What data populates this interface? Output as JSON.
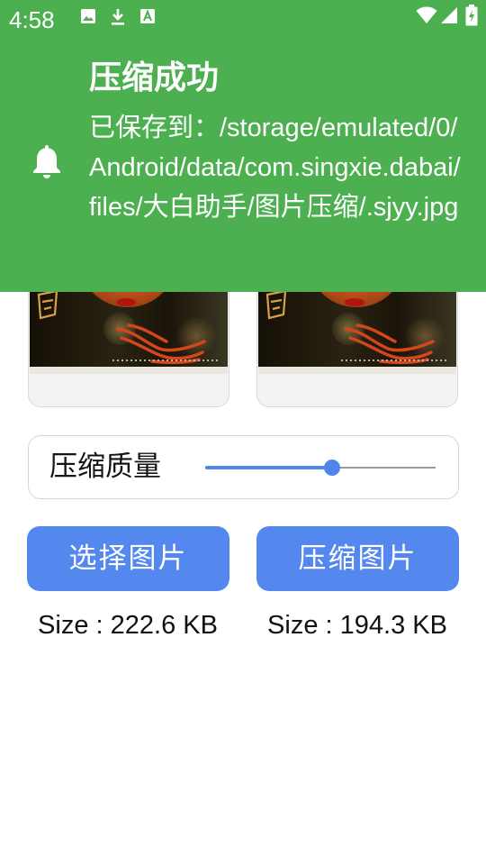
{
  "status_bar": {
    "time": "4:58",
    "left_icons": [
      "image-icon",
      "download-icon",
      "text-a-icon"
    ],
    "right_icons": [
      "wifi-icon",
      "cell-signal-icon",
      "battery-charging-icon"
    ]
  },
  "notification": {
    "title": "压缩成功",
    "body": "已保存到：/storage/emulated/0/Android/data/com.singxie.dabai/files/大白助手/图片压缩/.sjyy.jpg",
    "icon": "bell-icon",
    "background": "#4caf50"
  },
  "previews": {
    "original_alt": "original image",
    "compressed_alt": "compressed image"
  },
  "quality": {
    "label": "压缩质量",
    "value_fraction": 0.55,
    "accent": "#4f86ec"
  },
  "buttons": {
    "select_label": "选择图片",
    "compress_label": "压缩图片",
    "color": "#5488ee"
  },
  "sizes": {
    "original": "Size : 222.6 KB",
    "compressed": "Size : 194.3 KB"
  }
}
